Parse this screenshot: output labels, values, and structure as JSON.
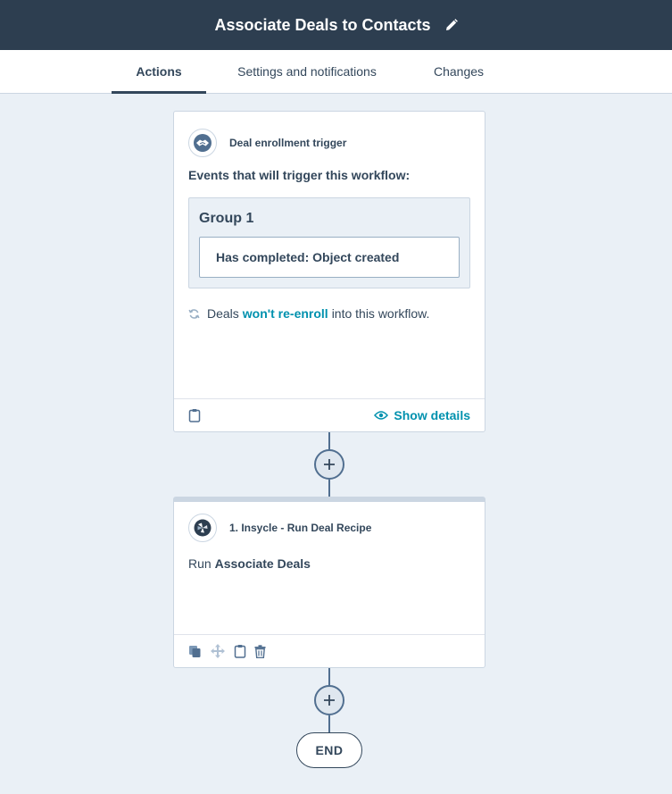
{
  "header": {
    "title": "Associate Deals to Contacts",
    "edit_icon": "pencil-icon"
  },
  "tabs": [
    {
      "label": "Actions",
      "active": true
    },
    {
      "label": "Settings and notifications",
      "active": false
    },
    {
      "label": "Changes",
      "active": false
    }
  ],
  "trigger_card": {
    "icon": "handshake-icon",
    "type_label": "Deal enrollment trigger",
    "events_label": "Events that will trigger this workflow:",
    "group_title": "Group 1",
    "filter": "Has completed: Object created",
    "reenroll_prefix": "Deals",
    "reenroll_link": "won't re-enroll",
    "reenroll_suffix": "into this workflow.",
    "show_details": "Show details"
  },
  "action_card": {
    "icon": "insycle-logo-icon",
    "title": "1. Insycle - Run Deal Recipe",
    "run_prefix": "Run",
    "run_target": "Associate Deals"
  },
  "end_label": "END",
  "colors": {
    "header_bg": "#2d3e50",
    "page_bg": "#eaf0f6",
    "link": "#0091ae",
    "text": "#33475b",
    "connector": "#516f90"
  }
}
